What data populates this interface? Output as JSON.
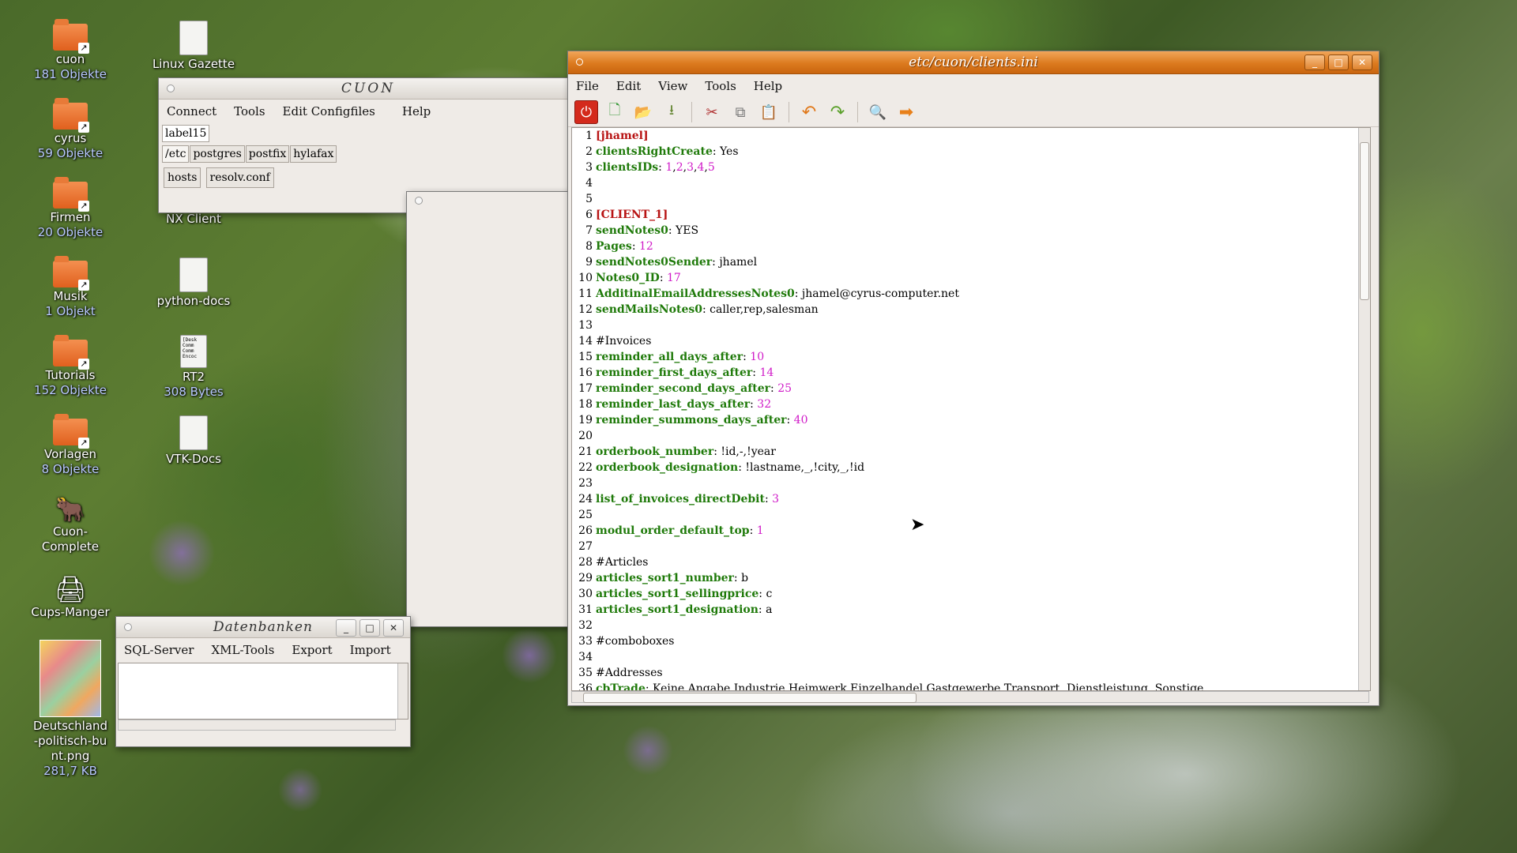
{
  "desktop": {
    "icons": [
      {
        "name": "cuon",
        "sub": "181 Objekte"
      },
      {
        "name": "cyrus",
        "sub": "59 Objekte"
      },
      {
        "name": "Firmen",
        "sub": "20 Objekte"
      },
      {
        "name": "Musik",
        "sub": "1 Objekt"
      },
      {
        "name": "Tutorials",
        "sub": "152 Objekte"
      },
      {
        "name": "Vorlagen",
        "sub": "8 Objekte"
      },
      {
        "name": "Cuon-Complete"
      },
      {
        "name": "Cups-Manger"
      },
      {
        "name": "Deutschland-politisch-bunt.png",
        "sub": "281,7 KB"
      },
      {
        "name": "Linux Gazette"
      },
      {
        "name": "NX Client"
      },
      {
        "name": "python-docs"
      },
      {
        "name": "RT2",
        "sub": "308 Bytes"
      },
      {
        "name": "VTK-Docs"
      }
    ]
  },
  "cuon": {
    "title": "CUON",
    "menu": [
      "Connect",
      "Tools",
      "Edit Configfiles",
      "Help"
    ],
    "label": "label15",
    "tabs": [
      "/etc",
      "postgres",
      "postfix",
      "hylafax"
    ],
    "files": [
      "hosts",
      "resolv.conf"
    ]
  },
  "datenbanken": {
    "title": "Datenbanken",
    "menu": [
      "SQL-Server",
      "XML-Tools",
      "Export",
      "Import"
    ]
  },
  "editor": {
    "title": "etc/cuon/clients.ini",
    "menu": [
      "File",
      "Edit",
      "View",
      "Tools",
      "Help"
    ],
    "toolbar": [
      "power-icon",
      "new-file-icon",
      "open-folder-icon",
      "save-icon",
      "cut-icon",
      "copy-icon",
      "paste-icon",
      "undo-icon",
      "redo-icon",
      "search-icon",
      "forward-arrow-icon"
    ],
    "lines": [
      {
        "n": "1",
        "parts": [
          [
            "sec",
            "[jhamel]"
          ]
        ]
      },
      {
        "n": "2",
        "parts": [
          [
            "k",
            "clientsRightCreate"
          ],
          [
            "p",
            ": Yes"
          ]
        ]
      },
      {
        "n": "3",
        "parts": [
          [
            "k",
            "clientsIDs"
          ],
          [
            "p",
            ": "
          ],
          [
            "num",
            "1"
          ],
          [
            "p",
            ","
          ],
          [
            "num",
            "2"
          ],
          [
            "p",
            ","
          ],
          [
            "num",
            "3"
          ],
          [
            "p",
            ","
          ],
          [
            "num",
            "4"
          ],
          [
            "p",
            ","
          ],
          [
            "num",
            "5"
          ]
        ]
      },
      {
        "n": "4",
        "parts": []
      },
      {
        "n": "5",
        "parts": []
      },
      {
        "n": "6",
        "parts": [
          [
            "sec",
            "[CLIENT_1]"
          ]
        ]
      },
      {
        "n": "7",
        "parts": [
          [
            "k",
            "sendNotes0"
          ],
          [
            "p",
            ": YES"
          ]
        ]
      },
      {
        "n": "8",
        "parts": [
          [
            "k",
            "Pages"
          ],
          [
            "p",
            ": "
          ],
          [
            "num",
            "12"
          ]
        ]
      },
      {
        "n": "9",
        "parts": [
          [
            "k",
            "sendNotes0Sender"
          ],
          [
            "p",
            ": jhamel"
          ]
        ]
      },
      {
        "n": "10",
        "parts": [
          [
            "k",
            "Notes0_ID"
          ],
          [
            "p",
            ": "
          ],
          [
            "num",
            "17"
          ]
        ]
      },
      {
        "n": "11",
        "parts": [
          [
            "k",
            "AdditinalEmailAddressesNotes0"
          ],
          [
            "p",
            ": jhamel@cyrus-computer.net"
          ]
        ]
      },
      {
        "n": "12",
        "parts": [
          [
            "k",
            "sendMailsNotes0"
          ],
          [
            "p",
            ": caller,rep,salesman"
          ]
        ]
      },
      {
        "n": "13",
        "parts": []
      },
      {
        "n": "14",
        "parts": [
          [
            "p",
            "#Invoices"
          ]
        ]
      },
      {
        "n": "15",
        "parts": [
          [
            "k",
            "reminder_all_days_after"
          ],
          [
            "p",
            ": "
          ],
          [
            "num",
            "10"
          ]
        ]
      },
      {
        "n": "16",
        "parts": [
          [
            "k",
            "reminder_first_days_after"
          ],
          [
            "p",
            ": "
          ],
          [
            "num",
            "14"
          ]
        ]
      },
      {
        "n": "17",
        "parts": [
          [
            "k",
            "reminder_second_days_after"
          ],
          [
            "p",
            ": "
          ],
          [
            "num",
            "25"
          ]
        ]
      },
      {
        "n": "18",
        "parts": [
          [
            "k",
            "reminder_last_days_after"
          ],
          [
            "p",
            ": "
          ],
          [
            "num",
            "32"
          ]
        ]
      },
      {
        "n": "19",
        "parts": [
          [
            "k",
            "reminder_summons_days_after"
          ],
          [
            "p",
            ": "
          ],
          [
            "num",
            "40"
          ]
        ]
      },
      {
        "n": "20",
        "parts": []
      },
      {
        "n": "21",
        "parts": [
          [
            "k",
            "orderbook_number"
          ],
          [
            "p",
            ": !id,-,!year"
          ]
        ]
      },
      {
        "n": "22",
        "parts": [
          [
            "k",
            "orderbook_designation"
          ],
          [
            "p",
            ": !lastname,_,!city,_,!id"
          ]
        ]
      },
      {
        "n": "23",
        "parts": []
      },
      {
        "n": "24",
        "parts": [
          [
            "k",
            "list_of_invoices_directDebit"
          ],
          [
            "p",
            ": "
          ],
          [
            "num",
            "3"
          ]
        ]
      },
      {
        "n": "25",
        "parts": []
      },
      {
        "n": "26",
        "parts": [
          [
            "k",
            "modul_order_default_top"
          ],
          [
            "p",
            ": "
          ],
          [
            "num",
            "1"
          ]
        ]
      },
      {
        "n": "27",
        "parts": []
      },
      {
        "n": "28",
        "parts": [
          [
            "p",
            "#Articles"
          ]
        ]
      },
      {
        "n": "29",
        "parts": [
          [
            "k",
            "articles_sort1_number"
          ],
          [
            "p",
            ": b"
          ]
        ]
      },
      {
        "n": "30",
        "parts": [
          [
            "k",
            "articles_sort1_sellingprice"
          ],
          [
            "p",
            ": c"
          ]
        ]
      },
      {
        "n": "31",
        "parts": [
          [
            "k",
            "articles_sort1_designation"
          ],
          [
            "p",
            ": a"
          ]
        ]
      },
      {
        "n": "32",
        "parts": []
      },
      {
        "n": "33",
        "parts": [
          [
            "p",
            "#comboboxes"
          ]
        ]
      },
      {
        "n": "34",
        "parts": []
      },
      {
        "n": "35",
        "parts": [
          [
            "p",
            "#Addresses"
          ]
        ]
      },
      {
        "n": "36",
        "parts": [
          [
            "k",
            "cbTrade"
          ],
          [
            "p",
            ": Keine Angabe,Industrie,Heimwerk,Einzelhandel,Gastgewerbe,Transport, Dienstleistung, Sonstige"
          ]
        ]
      }
    ]
  },
  "colors": {
    "keyword": "#1f7a0a",
    "section": "#b81414",
    "number": "#d01ac8",
    "titlebar": "#dc7a1e"
  }
}
